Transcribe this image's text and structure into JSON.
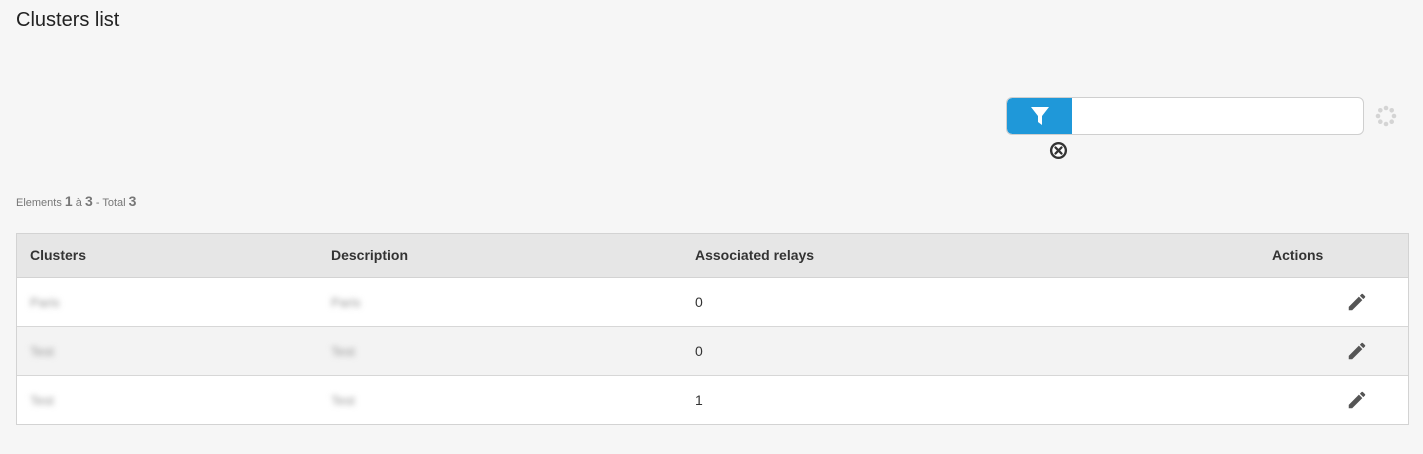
{
  "page": {
    "title": "Clusters list"
  },
  "filter": {
    "value": "",
    "icon": "funnel-icon",
    "clear_icon": "clear-circle-icon",
    "loading_icon": "spinner-icon",
    "accent_color": "#1f98d9"
  },
  "pager": {
    "elements_label": "Elements",
    "from": "1",
    "separator": "à",
    "to": "3",
    "total_label": "- Total",
    "total": "3"
  },
  "table": {
    "headers": {
      "clusters": "Clusters",
      "description": "Description",
      "associated_relays": "Associated relays",
      "actions": "Actions"
    },
    "rows": [
      {
        "cluster": "Paris",
        "description": "Paris",
        "relays": "0",
        "action_icon": "pencil-icon"
      },
      {
        "cluster": "Test",
        "description": "Test",
        "relays": "0",
        "action_icon": "pencil-icon"
      },
      {
        "cluster": "Test",
        "description": "Test",
        "relays": "1",
        "action_icon": "pencil-icon"
      }
    ]
  }
}
